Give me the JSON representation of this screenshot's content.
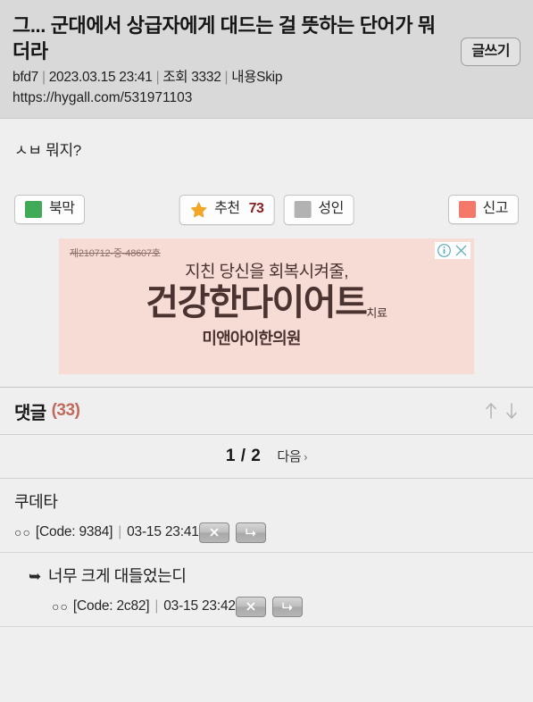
{
  "post": {
    "title": "그... 군대에서 상급자에게 대드는 걸 뜻하는 단어가 뭐더라",
    "write_button": "글쓰기",
    "author": "bfd7",
    "date": "2023.03.15 23:41",
    "views": "조회 3332",
    "skip": "내용Skip",
    "url": "https://hygall.com/531971103",
    "body": "ㅅㅂ 뭐지?"
  },
  "actions": {
    "bookmark_label": "북막",
    "bookmark_color": "#3faa57",
    "recommend_label": "추천",
    "recommend_count": "73",
    "recommend_count_color": "#8e1f20",
    "star_color": "#f5a623",
    "adult_label": "성인",
    "adult_color": "#b2b2b2",
    "report_label": "신고",
    "report_color": "#f5796a"
  },
  "ad": {
    "registration": "제210712-중-48607호",
    "line1": "지친 당신을 회복시켜줄,",
    "line2_a": "건강한",
    "line2_b": "다이어트",
    "line2_suffix": "치료",
    "line3": "미앤아이한의원",
    "bg_color": "#f7dcd5",
    "text_color": "#4a3330",
    "info_icon": "info-circle-icon",
    "close_icon": "close-x-icon",
    "control_color": "#5aa8bd"
  },
  "comments": {
    "title": "댓글",
    "count": "(33)",
    "count_color": "#c0695c",
    "sort_up_icon": "arrow-up-icon",
    "sort_down_icon": "arrow-down-icon",
    "pager": {
      "position": "1 / 2",
      "next_label": "다음",
      "next_chevron": "›"
    },
    "items": [
      {
        "text": "쿠데타",
        "is_reply": false,
        "dots": "○○",
        "code": "[Code: 9384]",
        "time": "03-15 23:41",
        "delete_icon": "close-x-icon",
        "reply_icon": "reply-arrow-icon"
      },
      {
        "text": "너무 크게 대들었는디",
        "is_reply": true,
        "reply_marker": "➥",
        "dots": "○○",
        "code": "[Code: 2c82]",
        "time": "03-15 23:42",
        "delete_icon": "close-x-icon",
        "reply_icon": "reply-arrow-icon"
      }
    ]
  }
}
